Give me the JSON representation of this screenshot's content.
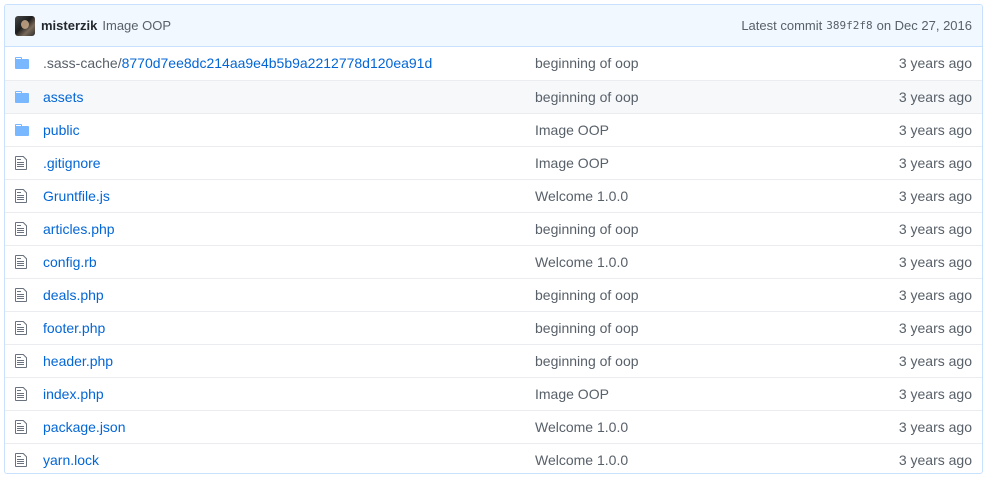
{
  "commit": {
    "author": "misterzik",
    "message": "Image OOP",
    "latest_label": "Latest commit",
    "sha": "389f2f8",
    "date": "on Dec 27, 2016"
  },
  "files": [
    {
      "type": "directory",
      "name_prefix": ".sass-cache/",
      "name": "8770d7ee8dc214aa9e4b5b9a2212778d120ea91d",
      "message": "beginning of oop",
      "age": "3 years ago",
      "icon": "folder-icon"
    },
    {
      "type": "directory",
      "name_prefix": "",
      "name": "assets",
      "message": "beginning of oop",
      "age": "3 years ago",
      "icon": "folder-icon"
    },
    {
      "type": "directory",
      "name_prefix": "",
      "name": "public",
      "message": "Image OOP",
      "age": "3 years ago",
      "icon": "folder-icon"
    },
    {
      "type": "file",
      "name_prefix": "",
      "name": ".gitignore",
      "message": "Image OOP",
      "age": "3 years ago",
      "icon": "file-icon"
    },
    {
      "type": "file",
      "name_prefix": "",
      "name": "Gruntfile.js",
      "message": "Welcome 1.0.0",
      "age": "3 years ago",
      "icon": "file-icon"
    },
    {
      "type": "file",
      "name_prefix": "",
      "name": "articles.php",
      "message": "beginning of oop",
      "age": "3 years ago",
      "icon": "file-icon"
    },
    {
      "type": "file",
      "name_prefix": "",
      "name": "config.rb",
      "message": "Welcome 1.0.0",
      "age": "3 years ago",
      "icon": "file-icon"
    },
    {
      "type": "file",
      "name_prefix": "",
      "name": "deals.php",
      "message": "beginning of oop",
      "age": "3 years ago",
      "icon": "file-icon"
    },
    {
      "type": "file",
      "name_prefix": "",
      "name": "footer.php",
      "message": "beginning of oop",
      "age": "3 years ago",
      "icon": "file-icon"
    },
    {
      "type": "file",
      "name_prefix": "",
      "name": "header.php",
      "message": "beginning of oop",
      "age": "3 years ago",
      "icon": "file-icon"
    },
    {
      "type": "file",
      "name_prefix": "",
      "name": "index.php",
      "message": "Image OOP",
      "age": "3 years ago",
      "icon": "file-icon"
    },
    {
      "type": "file",
      "name_prefix": "",
      "name": "package.json",
      "message": "Welcome 1.0.0",
      "age": "3 years ago",
      "icon": "file-icon"
    },
    {
      "type": "file",
      "name_prefix": "",
      "name": "yarn.lock",
      "message": "Welcome 1.0.0",
      "age": "3 years ago",
      "icon": "file-icon"
    }
  ],
  "colors": {
    "link": "#0366d6",
    "muted": "#586069",
    "folder": "#79b8ff",
    "header_bg": "#f1f8ff",
    "border": "#c8e1ff"
  }
}
